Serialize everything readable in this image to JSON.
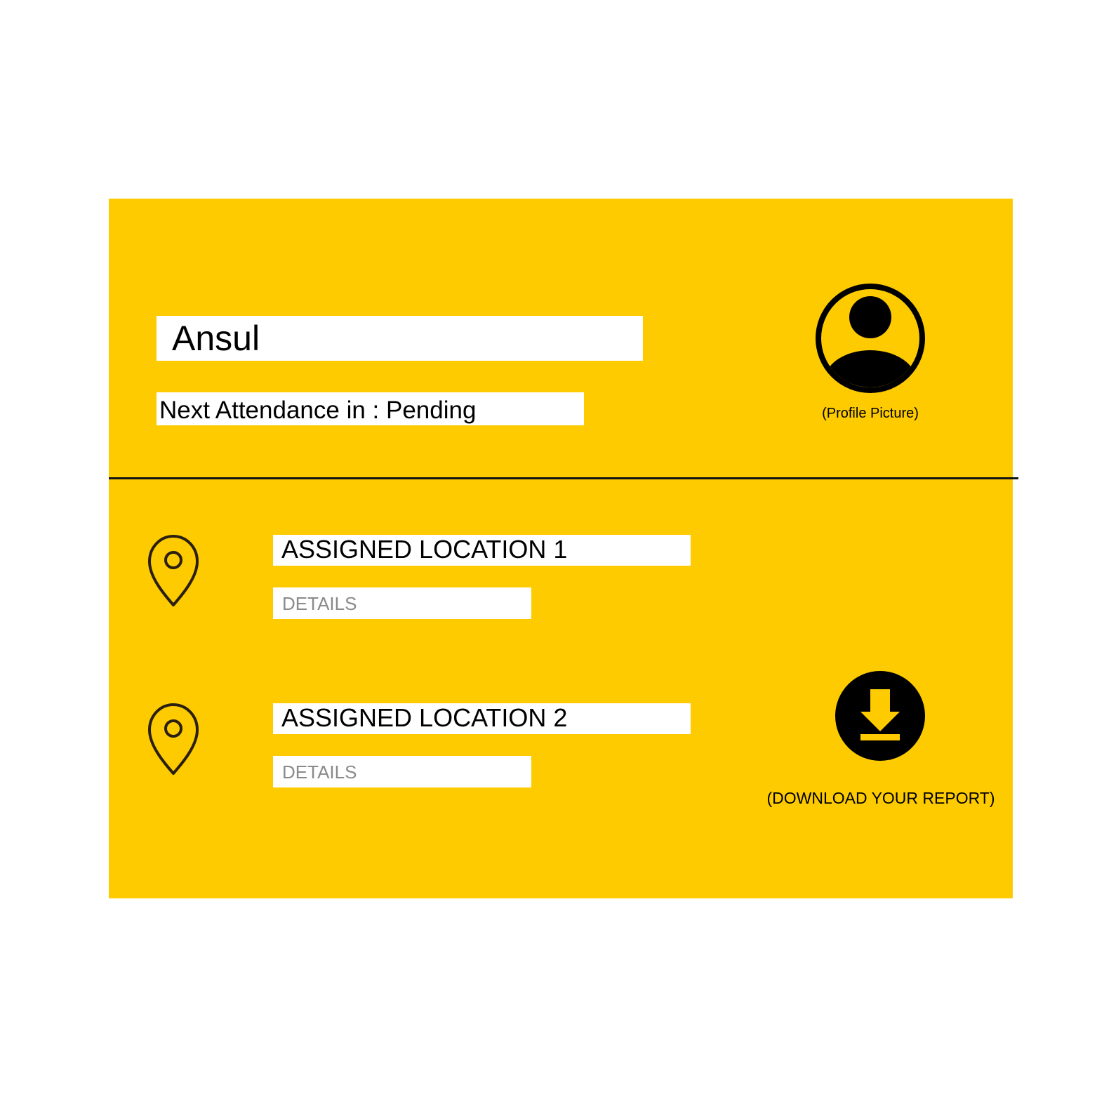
{
  "profile": {
    "name": "Ansul",
    "attendance_text": "Next Attendance in : Pending",
    "picture_caption": "(Profile Picture)",
    "picture_icon": "user-circle-icon"
  },
  "locations": [
    {
      "title": "ASSIGNED LOCATION 1",
      "details": "DETAILS",
      "icon": "map-pin-icon"
    },
    {
      "title": "ASSIGNED LOCATION 2",
      "details": "DETAILS",
      "icon": "map-pin-icon"
    }
  ],
  "report": {
    "caption": "(DOWNLOAD YOUR REPORT)",
    "icon": "download-icon"
  },
  "colors": {
    "background": "#FFFFFF",
    "card": "#FDCB00",
    "icon": "#000000",
    "details_text": "#8A8A8A"
  }
}
